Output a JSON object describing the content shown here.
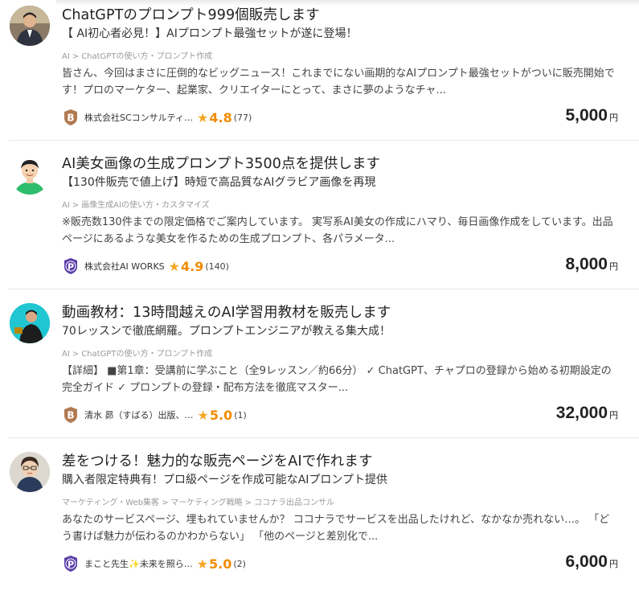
{
  "listings": [
    {
      "title": "ChatGPTのプロンプト999個販売します",
      "subtitle": "【 AI初心者必見！】AIプロンプト最強セットが遂に登場！",
      "breadcrumbs": [
        "AI",
        "ChatGPTの使い方・プロンプト作成"
      ],
      "desc_line1": "皆さん、今回はまさに圧倒的なビッグニュース！これまでにない画期的なAIプロンプト最強セットがついに販売開始で",
      "desc_line2": "す！プロのマーケター、起業家、クリエイターにとって、まさに夢のようなチャ...",
      "badge": "B",
      "seller": "株式会社SCコンサルティ…",
      "rating": "4.8",
      "count": "(77)",
      "price": "5,000",
      "currency": "円",
      "avatar_icon": "man-in-suit-avatar"
    },
    {
      "title": "AI美女画像の生成プロンプト3500点を提供します",
      "subtitle": "【130件販売で値上げ】時短で高品質なAIグラビア画像を再現",
      "breadcrumbs": [
        "AI",
        "画像生成AIの使い方・カスタマイズ"
      ],
      "desc_line1": "※販売数130件までの限定価格でご案内しています。 実写系AI美女の作成にハマり、毎日画像作成をしています。出品",
      "desc_line2": "ページにあるような美女を作るための生成プロンプト、各パラメータ...",
      "badge": "P",
      "seller": "株式会社AI WORKS",
      "rating": "4.9",
      "count": "(140)",
      "price": "8,000",
      "currency": "円",
      "avatar_icon": "cartoon-man-avatar"
    },
    {
      "title": "動画教材：13時間越えのAI学習用教材を販売します",
      "subtitle": "70レッスンで徹底網羅。プロンプトエンジニアが教える集大成！",
      "breadcrumbs": [
        "AI",
        "ChatGPTの使い方・プロンプト作成"
      ],
      "desc_line1": "【詳細】 ■第1章：受講前に学ぶこと（全9レッスン／約66分） ✓ ChatGPT、チャプロの登録から始める初期設定の",
      "desc_line2": "完全ガイド ✓ プロンプトの登録・配布方法を徹底マスター...",
      "badge": "B",
      "seller": "清水 昴（すばる）出版、…",
      "rating": "5.0",
      "count": "(1)",
      "price": "32,000",
      "currency": "円",
      "avatar_icon": "presenter-avatar"
    },
    {
      "title": "差をつける！魅力的な販売ページをAIで作れます",
      "subtitle": "購入者限定特典有！プロ級ページを作成可能なAIプロンプト提供",
      "breadcrumbs": [
        "マーケティング・Web集客",
        "マーケティング戦略",
        "ココナラ出品コンサル"
      ],
      "desc_line1": "あなたのサービスページ、埋もれていませんか？ ココナラでサービスを出品したけれど、なかなか売れない…。 「ど",
      "desc_line2": "う書けば魅力が伝わるのかわからない」 「他のページと差別化で...",
      "badge": "P",
      "seller": "まこと先生✨未来を照ら…",
      "rating": "5.0",
      "count": "(2)",
      "price": "6,000",
      "currency": "円",
      "avatar_icon": "glasses-man-avatar"
    }
  ],
  "colors": {
    "bronze_badge": "#b27a52",
    "platinum_badge": "#5b3fa8",
    "star": "#f5a623",
    "rating_text": "#f08c00"
  }
}
